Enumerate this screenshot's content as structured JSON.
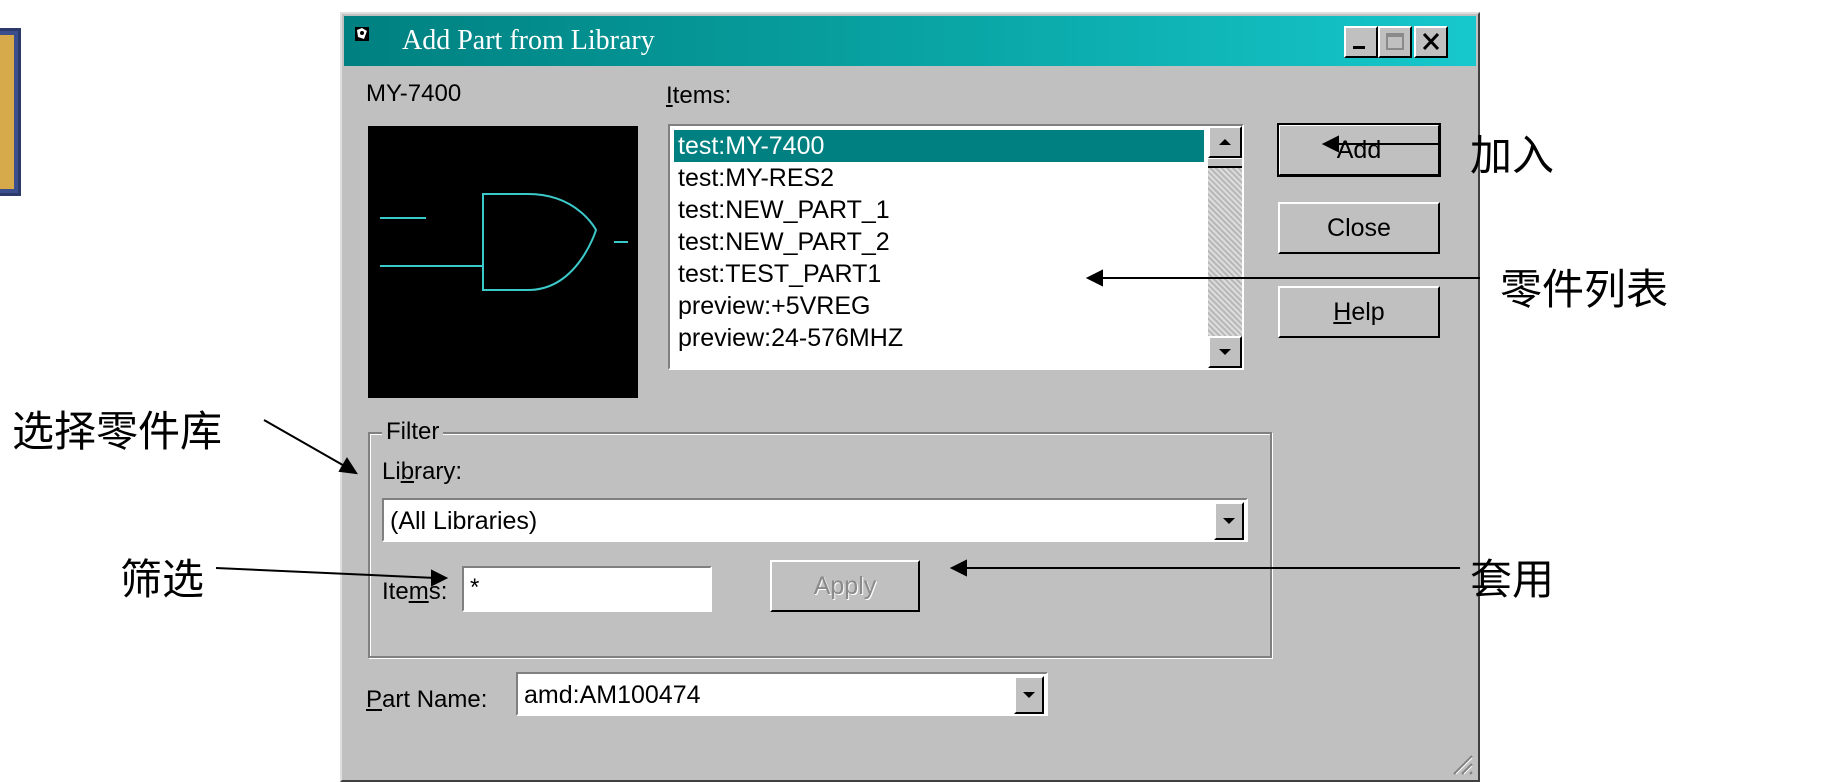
{
  "dialog": {
    "title": "Add Part from Library",
    "preview_label": "MY-7400",
    "items_label": "Items:",
    "items": [
      "test:MY-7400",
      "test:MY-RES2",
      "test:NEW_PART_1",
      "test:NEW_PART_2",
      "test:TEST_PART1",
      "preview:+5VREG",
      "preview:24-576MHZ"
    ],
    "selected_index": 0,
    "buttons": {
      "add": "Add",
      "close": "Close",
      "help": "Help"
    },
    "filter": {
      "group_label": "Filter",
      "library_label": "Library:",
      "library_value": "(All Libraries)",
      "items_label": "Items:",
      "items_value": "*",
      "apply_label": "Apply"
    },
    "part_name_label": "Part Name:",
    "part_name_value": "amd:AM100474"
  },
  "annotations": {
    "add": "加入",
    "parts_list": "零件列表",
    "select_library": "选择零件库",
    "filter": "筛选",
    "apply": "套用"
  },
  "colors": {
    "title_bar": "#008080",
    "selection": "#008080",
    "dialog_face": "#c0c0c0",
    "schematic_stroke": "#3cc9c9"
  }
}
